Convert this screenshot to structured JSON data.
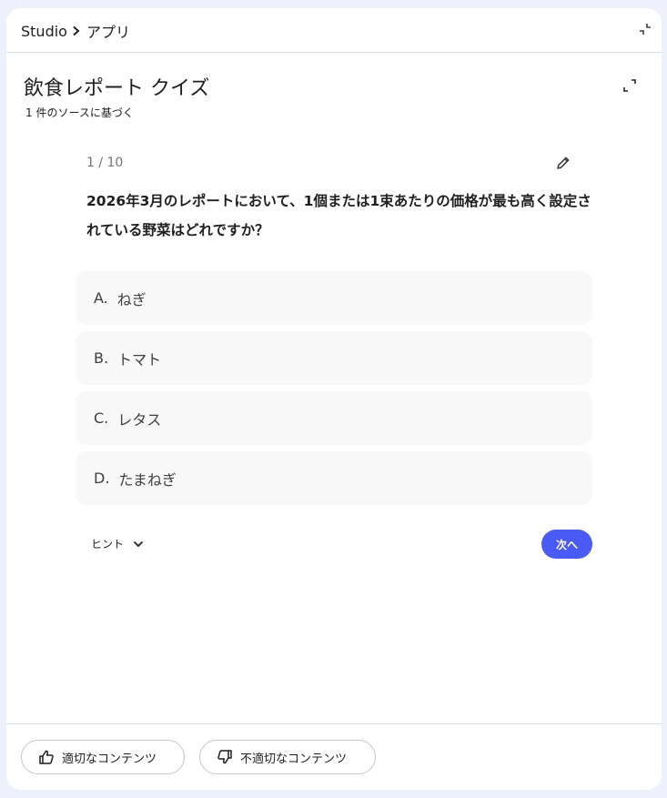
{
  "breadcrumb": {
    "root": "Studio",
    "current": "アプリ"
  },
  "quiz": {
    "title": "飲食レポート クイズ",
    "subtitle": "1 件のソースに基づく",
    "progress": "1 / 10",
    "question": "2026年3月のレポートにおいて、1個または1束あたりの価格が最も高く設定されている野菜はどれですか？",
    "options": [
      {
        "letter": "A.",
        "text": "ねぎ"
      },
      {
        "letter": "B.",
        "text": "トマト"
      },
      {
        "letter": "C.",
        "text": "レタス"
      },
      {
        "letter": "D.",
        "text": "たまねぎ"
      }
    ],
    "hint_label": "ヒント",
    "next_label": "次へ"
  },
  "feedback": {
    "good_label": "適切なコンテンツ",
    "bad_label": "不適切なコンテンツ"
  },
  "icons": {
    "breadcrumb_separator": "chevron-right-icon",
    "collapse": "collapse-icon",
    "expand": "fullscreen-icon",
    "edit": "pencil-icon",
    "hint": "chevron-down-icon",
    "good": "thumb-up-icon",
    "bad": "thumb-down-icon"
  },
  "colors": {
    "accent": "#4a5bf5",
    "page_background": "#eef0fb",
    "option_background": "#f8f8f8"
  }
}
